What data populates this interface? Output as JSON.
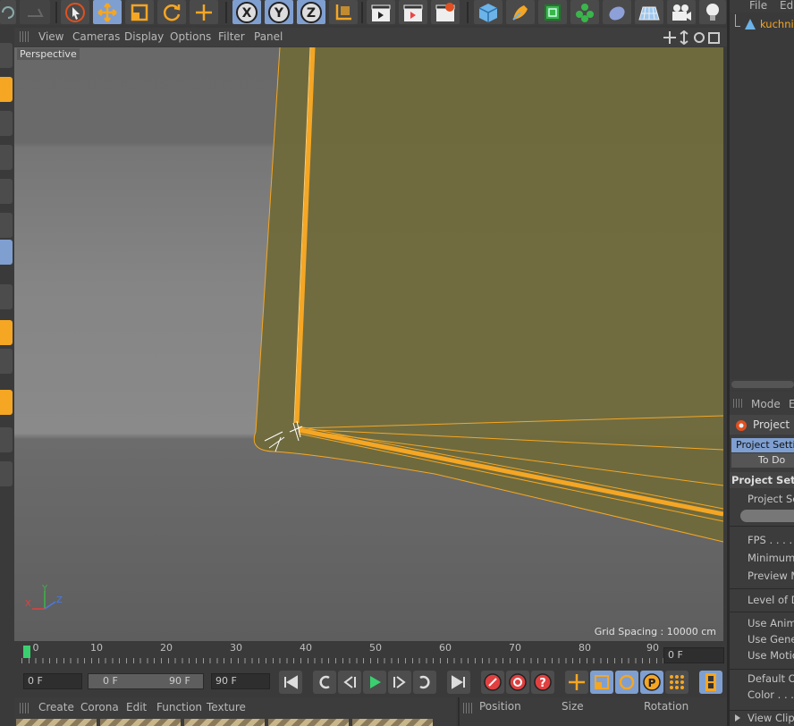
{
  "viewport": {
    "menu": [
      "View",
      "Cameras",
      "Display",
      "Options",
      "Filter",
      "Panel"
    ],
    "label": "Perspective",
    "grid_spacing": "Grid Spacing : 10000 cm",
    "axis_labels": {
      "x": "X",
      "y": "Y",
      "z": "Z"
    }
  },
  "timeline": {
    "ticks": [
      "0",
      "10",
      "20",
      "30",
      "40",
      "50",
      "60",
      "70",
      "80",
      "90"
    ],
    "current_frame_field": "0 F",
    "start_field": "0 F",
    "range_left": "0 F",
    "range_right": "90 F",
    "end_field": "90 F"
  },
  "object_manager": {
    "menu": [
      "File",
      "Edi"
    ],
    "object_name": "kuchnia"
  },
  "attributes": {
    "mode_menu": [
      "Mode",
      "E"
    ],
    "section": "Project",
    "tabs": [
      "Project Settin",
      "To Do"
    ],
    "header": "Project Settin",
    "rows": [
      "Project Sca",
      "FPS . . . . .",
      "Minimum",
      "Preview M",
      "Level of D",
      "Use Anima",
      "Use Gener",
      "Use Motic",
      "Default Ob",
      "Color . . .",
      "View Clippi"
    ]
  },
  "material_manager": {
    "menu": [
      "Create",
      "Corona",
      "Edit",
      "Function",
      "Texture"
    ]
  },
  "coordinates": {
    "headers": [
      "Position",
      "Size",
      "Rotation"
    ]
  },
  "colors": {
    "accent_orange": "#f5a623",
    "selection_blue": "#7f9fd0",
    "object_fill": "#6f6a3c"
  },
  "icons": [
    "undo-icon",
    "redo-icon",
    "live-select-icon",
    "move-icon",
    "scale-icon",
    "rotate-icon",
    "add-move-icon",
    "x-axis-icon",
    "y-axis-icon",
    "z-axis-icon",
    "coordinate-system-icon",
    "render-view-icon",
    "render-picture-viewer-icon",
    "edit-render-settings-icon",
    "cube-icon",
    "pen-icon",
    "subdivision-icon",
    "cloner-icon",
    "deformer-icon",
    "floor-icon",
    "camera-icon",
    "light-icon"
  ]
}
